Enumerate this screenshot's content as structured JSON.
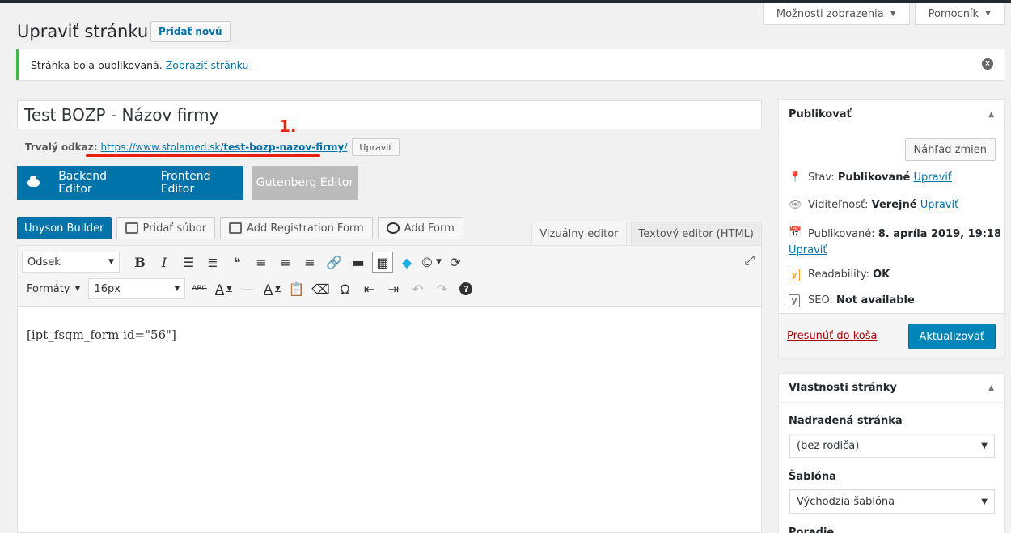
{
  "screen_meta": {
    "screen_options": "Možnosti zobrazenia",
    "help": "Pomocník"
  },
  "header": {
    "title": "Upraviť stránku",
    "add_new": "Pridať novú"
  },
  "notice": {
    "text": "Stránka bola publikovaná.",
    "link": "Zobraziť stránku",
    "dismiss": "×"
  },
  "post": {
    "title": "Test BOZP - Názov firmy",
    "permalink_label": "Trvalý odkaz:",
    "permalink_base": "https://www.stolamed.sk/",
    "permalink_slug": "test-bozp-nazov-firmy",
    "permalink_end": "/",
    "edit_slug": "Upraviť",
    "annotation": "1."
  },
  "editor_switch": {
    "backend": "Backend Editor",
    "frontend": "Frontend Editor",
    "gutenberg": "Gutenberg Editor"
  },
  "media_buttons": {
    "unyson": "Unyson Builder",
    "add_media": "Pridať súbor",
    "add_registration": "Add Registration Form",
    "add_form": "Add Form"
  },
  "tabs": {
    "visual": "Vizuálny editor",
    "text": "Textový editor (HTML)"
  },
  "toolbar": {
    "format_select": "Odsek",
    "formats": "Formáty",
    "font_size": "16px",
    "strike": "ABC",
    "bg_color": "A",
    "text_color": "A",
    "omega": "Ω",
    "help": "?"
  },
  "content": "[ipt_fsqm_form id=\"56\"]",
  "publish_box": {
    "title": "Publikovať",
    "preview": "Náhľad zmien",
    "status_label": "Stav:",
    "status_value": "Publikované",
    "visibility_label": "Viditeľnosť:",
    "visibility_value": "Verejné",
    "published_label": "Publikované:",
    "published_value": "8. apríla 2019, 19:18",
    "edit": "Upraviť",
    "readability_label": "Readability:",
    "readability_value": "OK",
    "seo_label": "SEO:",
    "seo_value": "Not available",
    "trash": "Presunúť do koša",
    "update": "Aktualizovať"
  },
  "attributes_box": {
    "title": "Vlastnosti stránky",
    "parent_label": "Nadradená stránka",
    "parent_value": "(bez rodiča)",
    "template_label": "Šablóna",
    "template_value": "Východzia šablóna",
    "order_label": "Poradie"
  }
}
